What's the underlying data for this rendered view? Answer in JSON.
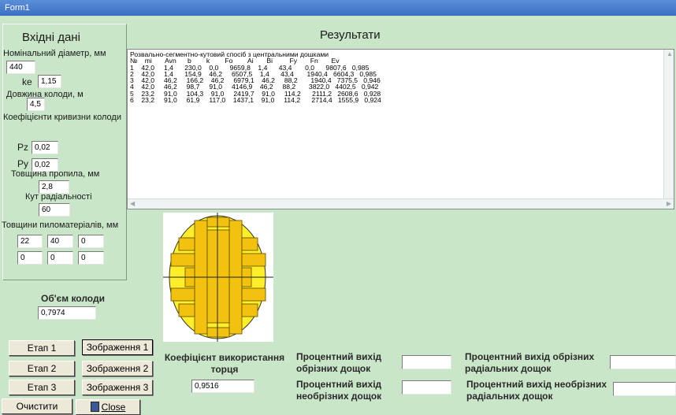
{
  "window": {
    "title": "Form1"
  },
  "input_panel": {
    "heading": "Вхідні дані",
    "diameter_label": "Номінальний діаметр, мм",
    "diameter_value": "440",
    "ke_label": "ke",
    "ke_value": "1,15",
    "length_label": "Довжина колоди, м",
    "length_value": "4,5",
    "curvature_label": "Коефіцієнти кривизни колоди",
    "pz_label": "Pz",
    "pz_value": "0,02",
    "py_label": "Py",
    "py_value": "0,02",
    "kerf_label": "Товщина пропила, мм",
    "kerf_value": "2,8",
    "angle_label": "Кут радіальності",
    "angle_value": "60",
    "thickness_label": "Товщини пиломатеріалів, мм",
    "thickness_values": [
      "22",
      "40",
      "0",
      "0",
      "0",
      "0"
    ],
    "volume_label": "Об'єм колоди",
    "volume_value": "0,7974"
  },
  "results": {
    "heading": "Результати",
    "method_title": "Розвально-сегментно-кутовий спосіб з центральними дошками",
    "columns": [
      "№",
      "mi",
      "Avn",
      "b",
      "k",
      "Fo",
      "Ai",
      "Bi",
      "Fy",
      "Fn",
      "Ev"
    ],
    "rows": [
      [
        "1",
        "42,0",
        "1,4",
        "230,0",
        "0,0",
        "9659,8",
        "1,4",
        "43,4",
        "0,0",
        "9807,6",
        "0,985"
      ],
      [
        "2",
        "42,0",
        "1,4",
        "154,9",
        "46,2",
        "6507,5",
        "1,4",
        "43,4",
        "1940,4",
        "6604,3",
        "0,985"
      ],
      [
        "3",
        "42,0",
        "46,2",
        "166,2",
        "46,2",
        "6979,1",
        "46,2",
        "88,2",
        "1940,4",
        "7375,5",
        "0,946"
      ],
      [
        "4",
        "42,0",
        "46,2",
        "98,7",
        "91,0",
        "4146,9",
        "46,2",
        "88,2",
        "3822,0",
        "4402,5",
        "0,942"
      ],
      [
        "5",
        "23,2",
        "91,0",
        "104,3",
        "91,0",
        "2419,7",
        "91,0",
        "114,2",
        "2111,2",
        "2608,6",
        "0,928"
      ],
      [
        "6",
        "23,2",
        "91,0",
        "61,9",
        "117,0",
        "1437,1",
        "91,0",
        "114,2",
        "2714,4",
        "1555,9",
        "0,924"
      ]
    ]
  },
  "buttons": {
    "stage1": "Етап 1",
    "stage2": "Етап 2",
    "stage3": "Етап 3",
    "image1": "Зображення 1",
    "image2": "Зображення 2",
    "image3": "Зображення 3",
    "clear": "Очистити",
    "close": "Close"
  },
  "outputs": {
    "usage_coef_label": "Коефіцієнт використання торця",
    "usage_coef_value": "0,9516",
    "edged_pct_label": "Процентний вихід обрізних дощок",
    "edged_pct_value": "",
    "unedged_pct_label": "Процентний вихід необрізних дощок",
    "unedged_pct_value": "",
    "edged_radial_pct_label": "Процентний вихід обрізних радіальних дощок",
    "edged_radial_pct_value": "",
    "unedged_radial_pct_label": "Процентний вихід необрізних радіальних дощок",
    "unedged_radial_pct_value": ""
  },
  "colors": {
    "form_bg": "#c9e6c9",
    "board_fill": "#f3c20f",
    "board_edge": "#5a4a00"
  },
  "icons": {
    "close_icon": "door-exit-icon"
  }
}
